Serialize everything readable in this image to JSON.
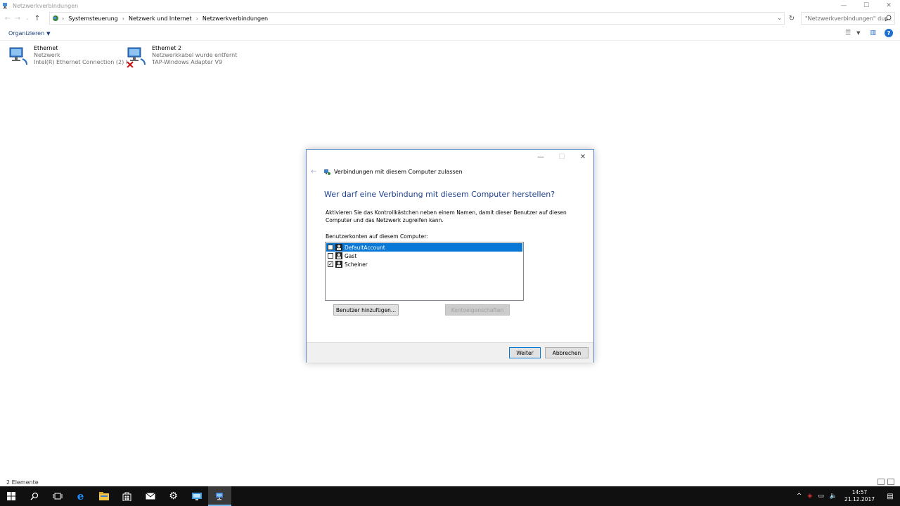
{
  "explorer": {
    "title": "Netzwerkverbindungen",
    "breadcrumbs": [
      "Systemsteuerung",
      "Netzwerk und Internet",
      "Netzwerkverbindungen"
    ],
    "search_placeholder": "\"Netzwerkverbindungen\" dur...",
    "organize_label": "Organizieren",
    "connections": [
      {
        "name": "Ethernet",
        "status": "Netzwerk",
        "adapter": "Intel(R) Ethernet Connection (2) I...",
        "disconnected": false
      },
      {
        "name": "Ethernet 2",
        "status": "Netzwerkkabel wurde entfernt",
        "adapter": "TAP-Windows Adapter V9",
        "disconnected": true
      }
    ],
    "status_count": "2 Elemente"
  },
  "dialog": {
    "title": "Verbindungen mit diesem Computer zulassen",
    "heading": "Wer darf eine Verbindung mit diesem Computer herstellen?",
    "description": "Aktivieren Sie das Kontrollkästchen neben einem Namen, damit dieser Benutzer auf diesen Computer und das Netzwerk zugreifen kann.",
    "list_label": "Benutzerkonten auf diesem Computer:",
    "users": [
      {
        "name": "DefaultAccount",
        "checked": false,
        "selected": true
      },
      {
        "name": "Gast",
        "checked": false,
        "selected": false
      },
      {
        "name": "Scheiner",
        "checked": true,
        "selected": false
      }
    ],
    "add_user_label": "Benutzer hinzufügen...",
    "properties_label": "Kontoeigenschaften",
    "next_label": "Weiter",
    "cancel_label": "Abbrechen"
  },
  "taskbar": {
    "time": "14:57",
    "date": "21.12.2017"
  },
  "colors": {
    "accent": "#0a78d7",
    "heading": "#1e3f8f",
    "taskbar": "#101010"
  }
}
